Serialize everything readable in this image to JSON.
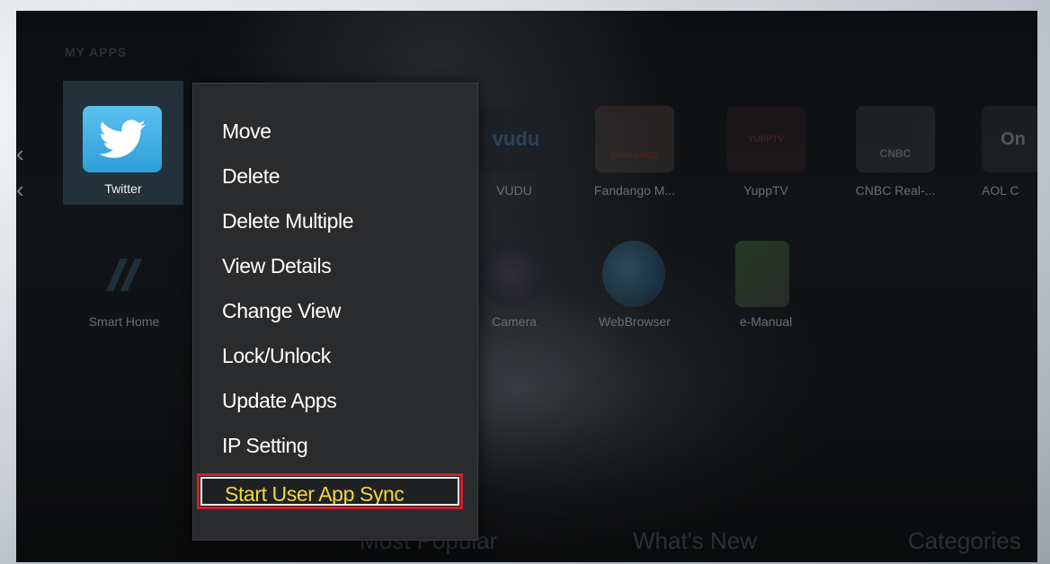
{
  "section": {
    "title": "MY APPS"
  },
  "apps": [
    {
      "label": "Twitter",
      "icon": "twitter-bird-icon"
    },
    {
      "label": "VUDU",
      "icon": "vudu-logo-icon",
      "icon_text": "vudu"
    },
    {
      "label": "Fandango M...",
      "icon": "fandango-logo-icon",
      "icon_text": "FANDANGO"
    },
    {
      "label": "YuppTV",
      "icon": "yupptv-logo-icon",
      "icon_text": "YUPPTV"
    },
    {
      "label": "CNBC Real-...",
      "icon": "cnbc-logo-icon",
      "icon_text": "CNBC"
    },
    {
      "label": "AOL C",
      "icon": "aol-logo-icon",
      "icon_text": "On"
    },
    {
      "label": "Smart Home",
      "icon": "smart-home-icon"
    },
    {
      "label": "Camera",
      "icon": "camera-icon"
    },
    {
      "label": "WebBrowser",
      "icon": "globe-icon"
    },
    {
      "label": "e-Manual",
      "icon": "e-manual-icon"
    }
  ],
  "context_menu": {
    "items": [
      "Move",
      "Delete",
      "Delete Multiple",
      "View Details",
      "Change View",
      "Lock/Unlock",
      "Update Apps",
      "IP Setting",
      "Start User App Sync"
    ],
    "highlighted_index": 8
  },
  "bottom_tabs": [
    "Most Popular",
    "What's New",
    "Categories"
  ],
  "colors": {
    "highlight_border": "#d0202a",
    "highlight_text": "#f5d73a",
    "twitter_blue": "#2d9fd8"
  }
}
